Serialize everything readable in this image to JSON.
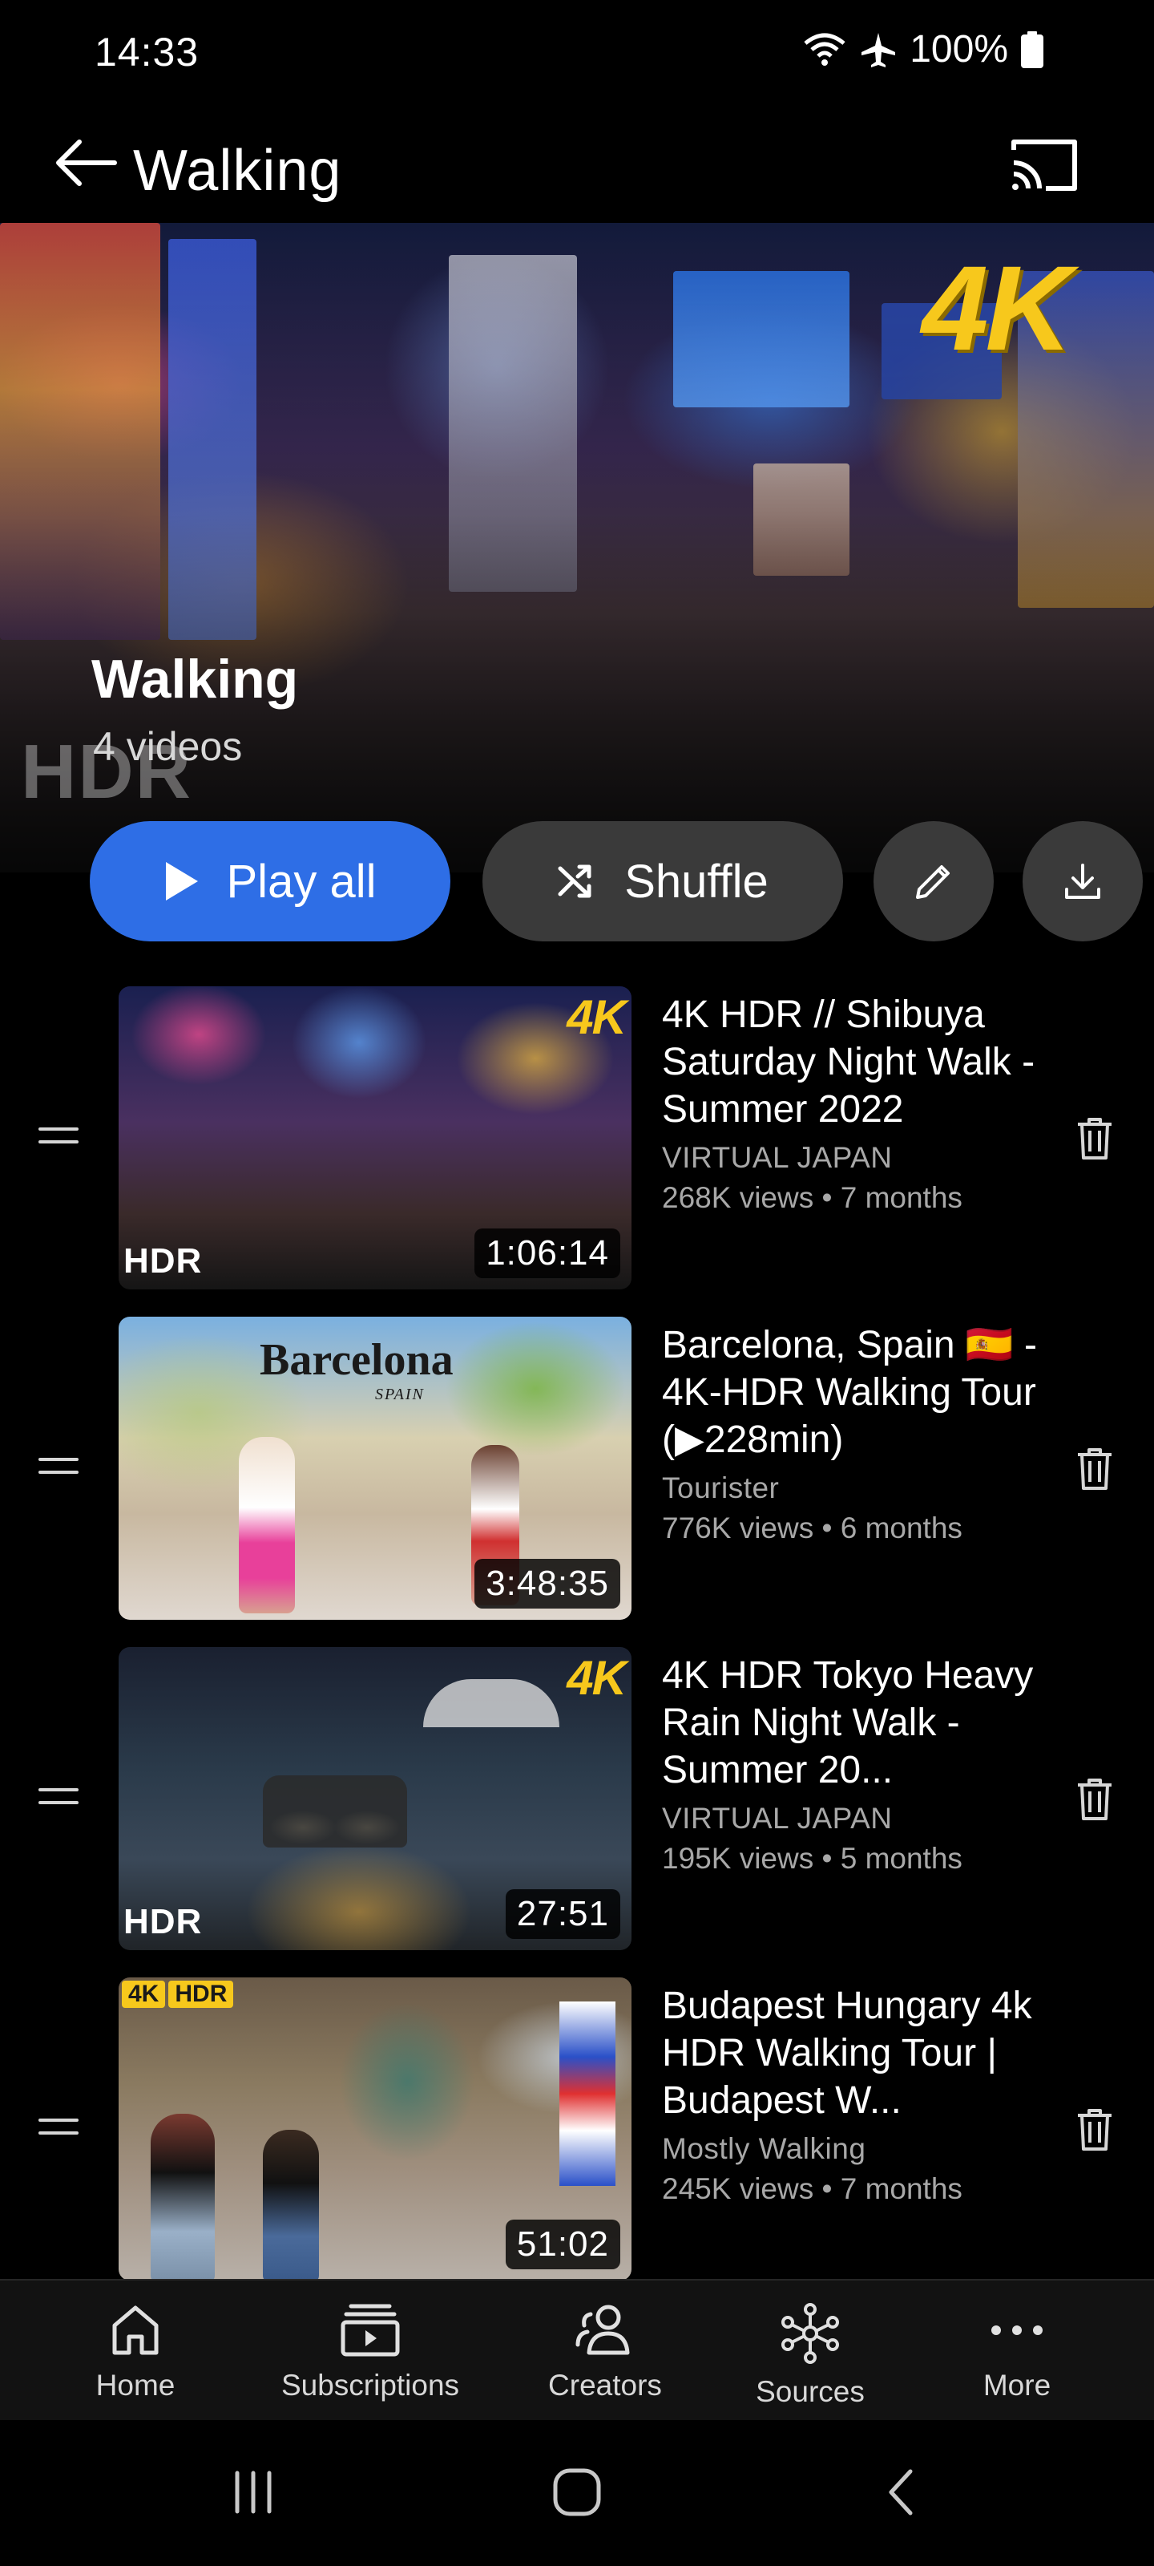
{
  "status_bar": {
    "time": "14:33",
    "battery": "100%"
  },
  "app_bar": {
    "title": "Walking",
    "back_icon": "arrow-left-icon",
    "cast_icon": "cast-icon"
  },
  "hero": {
    "title": "Walking",
    "video_count": "4 videos",
    "overlay_4k": "4K",
    "overlay_hdr": "HDR"
  },
  "actions": {
    "play_all": "Play all",
    "shuffle": "Shuffle",
    "edit_icon": "pencil-icon",
    "download_icon": "download-icon"
  },
  "videos": [
    {
      "title": "4K HDR // Shibuya Saturday Night Walk - Summer 2022",
      "channel": "VIRTUAL JAPAN",
      "stats": "268K views • 7 months",
      "duration": "1:06:14",
      "badge_hdr": "HDR",
      "badge_4k": "4K"
    },
    {
      "title": "Barcelona, Spain 🇪🇸 - 4K-HDR Walking Tour (▶228min)",
      "channel": "Tourister",
      "stats": "776K views • 6 months",
      "duration": "3:48:35",
      "thumb_text": "Barcelona",
      "thumb_subtext": "SPAIN"
    },
    {
      "title": "4K HDR Tokyo Heavy Rain Night Walk - Summer 20...",
      "channel": "VIRTUAL JAPAN",
      "stats": "195K views • 5 months",
      "duration": "27:51",
      "badge_hdr": "HDR",
      "badge_4k": "4K"
    },
    {
      "title": "Budapest Hungary 4k HDR Walking Tour | Budapest W...",
      "channel": "Mostly Walking",
      "stats": "245K views • 7 months",
      "duration": "51:02",
      "badge_4k": "4K",
      "badge_hdr": "HDR"
    }
  ],
  "bottom_nav": [
    {
      "label": "Home",
      "icon": "home-icon"
    },
    {
      "label": "Subscriptions",
      "icon": "subscriptions-icon"
    },
    {
      "label": "Creators",
      "icon": "creators-icon"
    },
    {
      "label": "Sources",
      "icon": "sources-icon"
    },
    {
      "label": "More",
      "icon": "more-icon"
    }
  ],
  "colors": {
    "accent": "#2e6ee6",
    "background": "#000000",
    "chip": "#3a3a3a",
    "secondary_text": "#a8a8a8"
  }
}
